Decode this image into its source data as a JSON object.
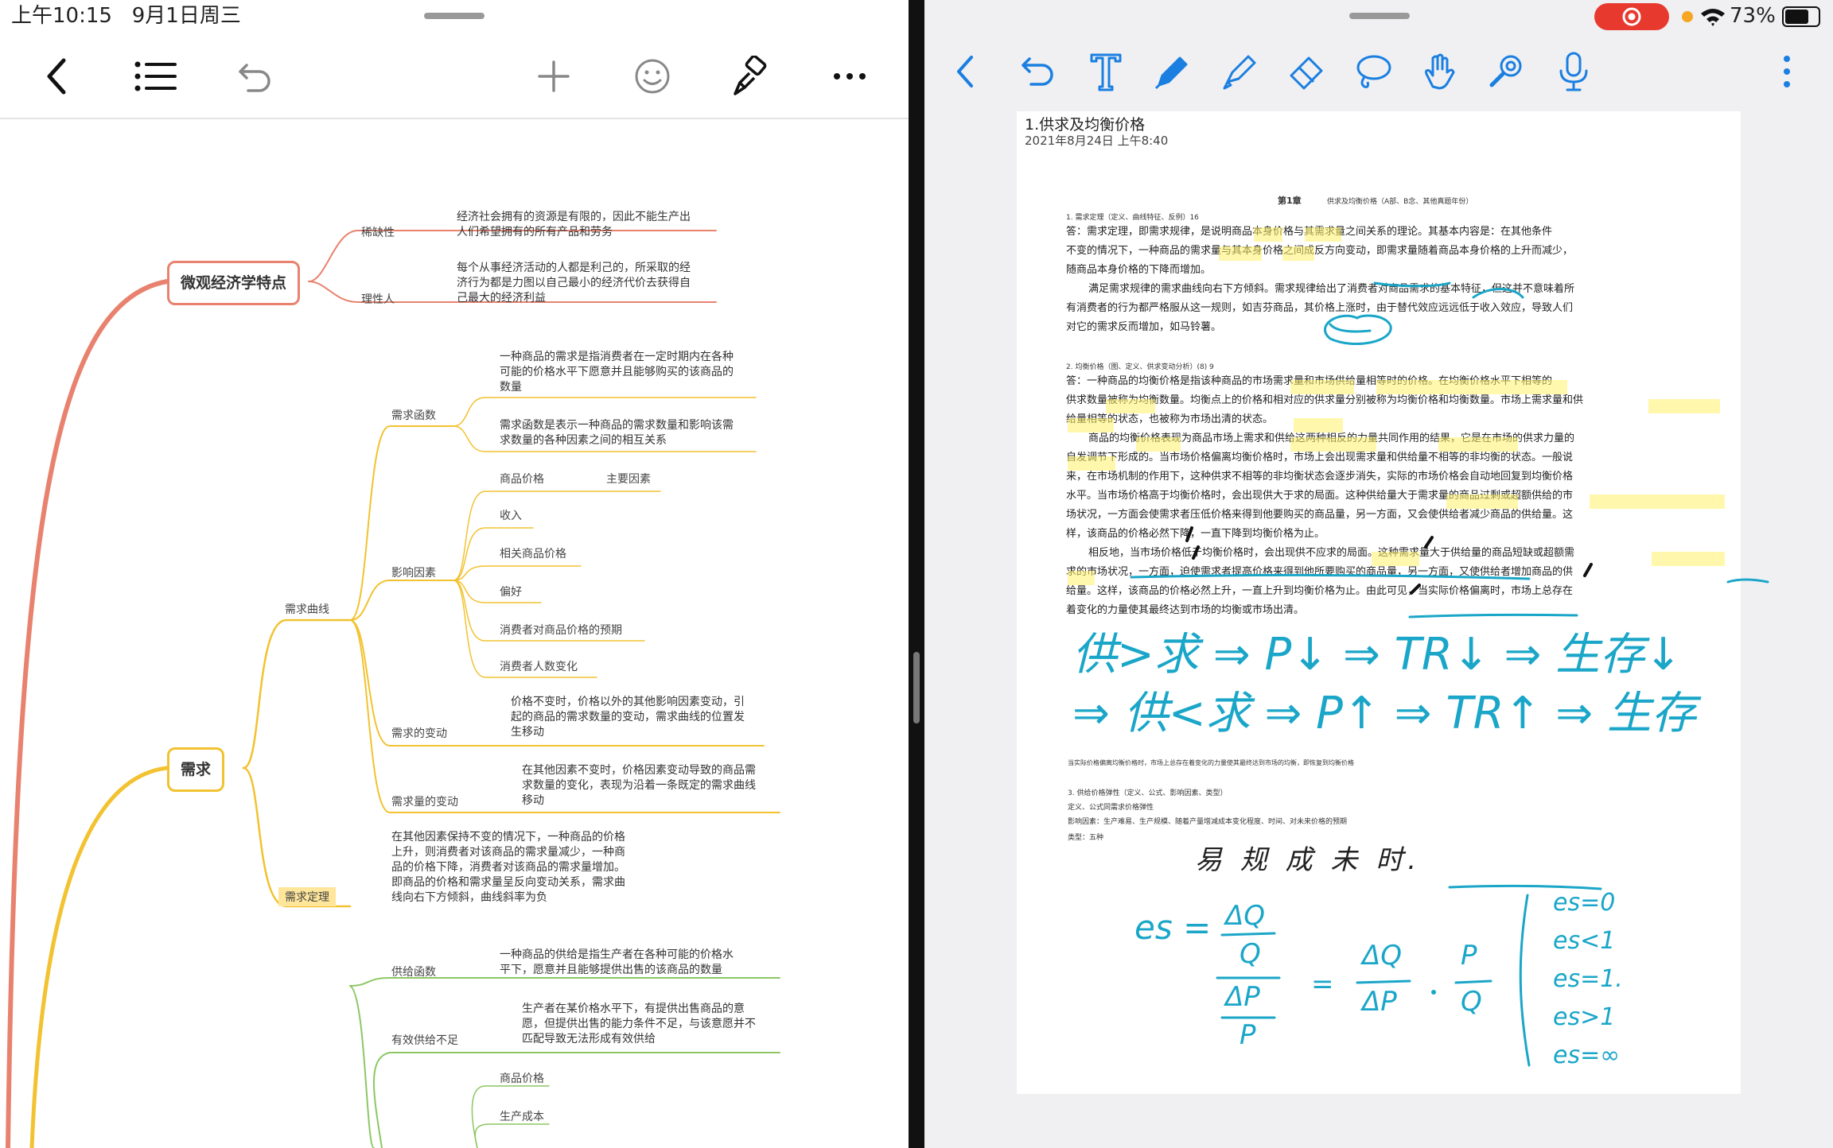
{
  "left_status": {
    "time": "上午10:15",
    "date": "9月1日周三"
  },
  "right_status": {
    "battery": "73%"
  },
  "left_toolbar": {
    "icons": [
      "back-icon",
      "outline-list-icon",
      "undo-icon",
      "add-icon",
      "emoji-icon",
      "format-brush-icon",
      "more-icon"
    ]
  },
  "right_toolbar": {
    "icons": [
      "back-icon",
      "undo-icon",
      "text-tool-icon",
      "pen-icon",
      "highlighter-icon",
      "eraser-icon",
      "lasso-icon",
      "hand-icon",
      "laser-icon",
      "mic-icon",
      "more-icon"
    ]
  },
  "mindmap": {
    "n1": {
      "title": "微观经济学特点",
      "c1": {
        "label": "稀缺性",
        "text1": "经济社会拥有的资源是有限的，因此不能生产出",
        "text2": "人们希望拥有的所有产品和劳务"
      },
      "c2": {
        "label": "理性人",
        "text1": "每个从事经济活动的人都是利己的，所采取的经",
        "text2": "济行为都是力图以自己最小的经济代价去获得自",
        "text3": "己最大的经济利益"
      }
    },
    "n2": {
      "title": "需求",
      "curve": "需求曲线",
      "func": {
        "label": "需求函数",
        "a1": "一种商品的需求是指消费者在一定时期内在各种",
        "a2": "可能的价格水平下愿意并且能够购买的该商品的",
        "a3": "数量",
        "b1": "需求函数是表示一种商品的需求数量和影响该需",
        "b2": "求数量的各种因素之间的相互关系"
      },
      "factors": {
        "label": "影响因素",
        "f1": "商品价格",
        "main": "主要因素",
        "f2": "收入",
        "f3": "相关商品价格",
        "f4": "偏好",
        "f5": "消费者对商品价格的预期",
        "f6": "消费者人数变化"
      },
      "change": {
        "label": "需求的变动",
        "t1": "价格不变时，价格以外的其他影响因素变动，引",
        "t2": "起的商品的需求数量的变动，需求曲线的位置发",
        "t3": "生移动"
      },
      "qchange": {
        "label": "需求量的变动",
        "t1": "在其他因素不变时，价格因素变动导致的商品需",
        "t2": "求数量的变化，表现为沿着一条既定的需求曲线",
        "t3": "移动"
      },
      "law": {
        "label": "需求定理",
        "t1": "在其他因素保持不变的情况下，一种商品的价格",
        "t2": "上升，则消费者对该商品的需求量减少，一种商",
        "t3": "品的价格下降，消费者对该商品的需求量增加。",
        "t4": "即商品的价格和需求量呈反向变动关系，需求曲",
        "t5": "线向右下方倾斜，曲线斜率为负"
      }
    },
    "n3": {
      "supply": {
        "label": "供给函数",
        "t1": "一种商品的供给是指生产者在各种可能的价格水",
        "t2": "平下，愿意并且能够提供出售的该商品的数量"
      },
      "lack": {
        "label": "有效供给不足",
        "t1": "生产者在某价格水平下，有提供出售商品的意",
        "t2": "愿，但提供出售的能力条件不足，与该意愿并不",
        "t3": "匹配导致无法形成有效供给"
      },
      "f1": "商品价格",
      "f2": "生产成本"
    }
  },
  "doc": {
    "title": "1.供求及均衡价格",
    "date": "2021年8月24日 上午8:40",
    "chapter": "第1章",
    "chapter_sub": "供求及均衡价格（A部、B念、其他真题年份）",
    "q1_head": "1.  需求定理（定义、曲线特征、反例）16",
    "q1_l1": "答：需求定理，即需求规律，是说明商品本身价格与其需求量之间关系的理论。其基本内容是：在其他条件",
    "q1_l2": "不变的情况下，一种商品的需求量与其本身价格之间成反方向变动，即需求量随着商品本身价格的上升而减少，",
    "q1_l3": "随商品本身价格的下降而增加。",
    "q1_l4": "满足需求规律的需求曲线向右下方倾斜。需求规律给出了消费者对商品需求的基本特征，但这并不意味着所",
    "q1_l5": "有消费者的行为都严格服从这一规则，如吉芬商品，其价格上涨时，由于替代效应远远低于收入效应，导致人们",
    "q1_l6": "对它的需求反而增加，如马铃薯。",
    "q2_head": "2.  均衡价格（图、定义、供求变动分析）(8) 9",
    "q2_l1": "答：一种商品的均衡价格是指该种商品的市场需求量和市场供给量相等时的价格。在均衡价格水平下相等的",
    "q2_l2": "供求数量被称为均衡数量。均衡点上的价格和相对应的供求量分别被称为均衡价格和均衡数量。市场上需求量和供",
    "q2_l3": "给量相等的状态，也被称为市场出清的状态。",
    "q2_l4": "商品的均衡价格表现为商品市场上需求和供给这两种相反的力量共同作用的结果，它是在市场的供求力量的",
    "q2_l5": "自发调节下形成的。当市场价格偏离均衡价格时，市场上会出现需求量和供给量不相等的非均衡的状态。一般说",
    "q2_l6": "来，在市场机制的作用下，这种供求不相等的非均衡状态会逐步消失，实际的市场价格会自动地回复到均衡价格",
    "q2_l7": "水平。当市场价格高于均衡价格时，会出现供大于求的局面。这种供给量大于需求量的商品过剩或超额供给的市",
    "q2_l8": "场状况，一方面会使需求者压低价格来得到他要购买的商品量，另一方面，又会使供给者减少商品的供给量。这",
    "q2_l9": "样，该商品的价格必然下降，一直下降到均衡价格为止。",
    "q2_l10": "相反地，当市场价格低于均衡价格时，会出现供不应求的局面。这种需求量大于供给量的商品短缺或超额需",
    "q2_l11": "求的市场状况，一方面，迫使需求者提高价格来得到他所要购买的商品量，另一方面，又使供给者增加商品的供",
    "q2_l12": "给量。这样，该商品的价格必然上升，一直上升到均衡价格为止。由此可见，当实际价格偏离时，市场上总存在",
    "q2_l13": "着变化的力量使其最终达到市场的均衡或市场出清。",
    "hw1": "供>求 ⇒ P↓ ⇒ TR↓ ⇒ 生存↓",
    "hw2": "⇒ 供<求 ⇒ P↑ ⇒ TR↑ ⇒ 生存",
    "tiny1": "当实际价格偏离均衡价格时，市场上总存在着变化的力量使其最终达到市场的均衡，即恢复到均衡价格",
    "q3_head": "3.  供给价格弹性（定义、公式、影响因素、类型）",
    "q3_l1": "定义、公式同需求价格弹性",
    "q3_l2": "影响因素：生产难易、生产规模、随着产量增减成本变化程度、时间、对未来价格的预期",
    "q3_l3": "类型：五种",
    "hw3": "易 规 成 未 时.",
    "hw_es": "es =",
    "hw_dq": "ΔQ",
    "hw_q": "Q",
    "hw_dp": "ΔP",
    "hw_p": "P",
    "hw_eq": "=",
    "hw_r1": "ΔQ",
    "hw_r2": "ΔP",
    "hw_r3": "P",
    "hw_r4": "Q",
    "hw_c1": "es=0",
    "hw_c2": "es<1",
    "hw_c3": "es=1.",
    "hw_c4": "es>1",
    "hw_c5": "es=∞"
  },
  "colors": {
    "red_branch": "#e8826f",
    "yellow_branch": "#f2c230",
    "green_branch": "#8cc764",
    "ink": "#1aa6c8",
    "highlight": "#fff36a",
    "record": "#e8392f"
  }
}
